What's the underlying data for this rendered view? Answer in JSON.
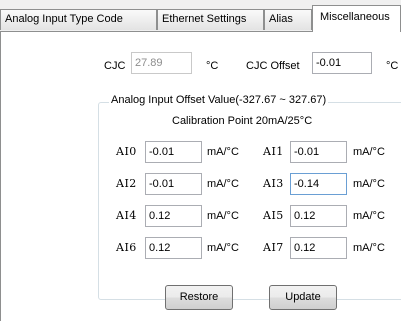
{
  "tabs": [
    {
      "label": "Analog Input Type Code"
    },
    {
      "label": "Ethernet Settings"
    },
    {
      "label": "Alias"
    },
    {
      "label": "Miscellaneous"
    }
  ],
  "cjc": {
    "label": "CJC",
    "value": "27.89",
    "unit": "°C"
  },
  "cjc_offset": {
    "label": "CJC Offset",
    "value": "-0.01",
    "unit": "°C"
  },
  "group": {
    "title": "Analog Input Offset Value(-327.67 ~ 327.67)",
    "calibration_point": "Calibration Point 20mA/25°C"
  },
  "channels": [
    {
      "label": "AI0",
      "value": "-0.01",
      "unit": "mA/°C"
    },
    {
      "label": "AI1",
      "value": "-0.01",
      "unit": "mA/°C"
    },
    {
      "label": "AI2",
      "value": "-0.01",
      "unit": "mA/°C"
    },
    {
      "label": "AI3",
      "value": "-0.14",
      "unit": "mA/°C"
    },
    {
      "label": "AI4",
      "value": "0.12",
      "unit": "mA/°C"
    },
    {
      "label": "AI5",
      "value": "0.12",
      "unit": "mA/°C"
    },
    {
      "label": "AI6",
      "value": "0.12",
      "unit": "mA/°C"
    },
    {
      "label": "AI7",
      "value": "0.12",
      "unit": "mA/°C"
    }
  ],
  "buttons": {
    "restore": "Restore",
    "update": "Update"
  }
}
